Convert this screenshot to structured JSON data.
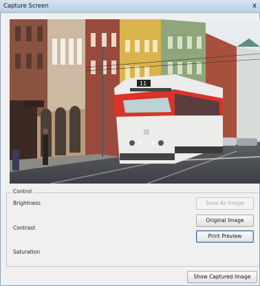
{
  "window": {
    "title": "Capture Screen",
    "close_glyph": "x"
  },
  "preview": {
    "image_subject": "red-and-white-tram-on-city-street",
    "tram_route": "11"
  },
  "control": {
    "group_label": "Control",
    "brightness_label": "Brightness",
    "contrast_label": "Contrast",
    "saturation_label": "Saturation",
    "save_as_image": "Save As Image",
    "original_image": "Original Image",
    "print_preview": "Print Preview"
  },
  "footer": {
    "show_captured_image": "Show Captured Image"
  },
  "colors": {
    "title_bar": "#c7d8ec",
    "window_bg": "#f0f0f0",
    "focus_border": "#3c6fa8"
  }
}
